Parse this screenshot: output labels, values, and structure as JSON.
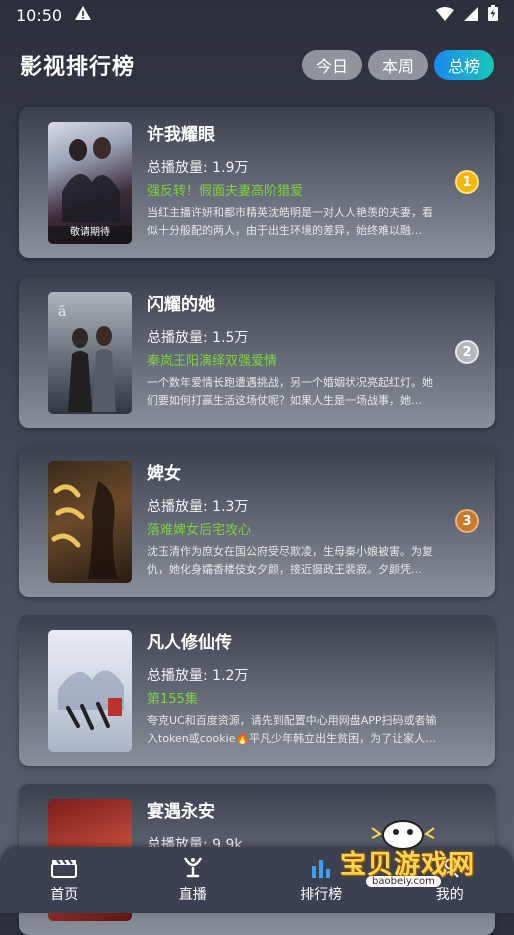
{
  "status_bar": {
    "time": "10:50",
    "icons": [
      "warning-icon",
      "wifi-icon",
      "signal-icon",
      "battery-icon"
    ]
  },
  "header": {
    "title": "影视排行榜",
    "tabs": [
      {
        "label": "今日",
        "active": false
      },
      {
        "label": "本周",
        "active": false
      },
      {
        "label": "总榜",
        "active": true
      }
    ]
  },
  "colors": {
    "active_tab_gradient": [
      "#1d87f0",
      "#17c8b8"
    ],
    "tag_green": "#7fd13f",
    "rank1": "#f2b705",
    "rank2": "#b5b9bf",
    "rank3": "#c77b2e"
  },
  "rankings": [
    {
      "title": "许我耀眼",
      "plays": "总播放量: 1.9万",
      "tagline": "强反转！假面夫妻高阶猎爱",
      "desc": "当红主播许妍和都市精英沈皓明是一对人人艳羡的夫妻，看似十分般配的两人，由于出生环境的差异，始终难以融…",
      "rank": "1",
      "poster_caption": "敬请期待"
    },
    {
      "title": "闪耀的她",
      "plays": "总播放量: 1.5万",
      "tagline": "秦岚王阳演绎双强爱情",
      "desc": "一个数年爱情长跑遭遇挑战，另一个婚姻状况亮起红灯。她们要如何打赢生活这场仗呢？如果人生是一场战事，她…",
      "rank": "2",
      "poster_caption": ""
    },
    {
      "title": "婢女",
      "plays": "总播放量: 1.3万",
      "tagline": "落难婢女后宅攻心",
      "desc": "沈玉清作为庶女在国公府受尽欺凌，生母秦小娘被害。为复仇，她化身孀香楼伎女夕颜，接近摄政王裴寂。夕颜凭…",
      "rank": "3",
      "poster_caption": ""
    },
    {
      "title": "凡人修仙传",
      "plays": "总播放量: 1.2万",
      "tagline": "第155集",
      "desc": "夸克UC和百度资源，请先到配置中心用网盘APP扫码或者输入token或cookie🔥平凡少年韩立出生贫困，为了让家人过上更好…",
      "rank": "",
      "poster_caption": ""
    },
    {
      "title": "宴遇永安",
      "plays": "总播放量: 9.9k",
      "tagline": "",
      "desc": "",
      "rank": "",
      "poster_caption": ""
    }
  ],
  "bottom_nav": [
    {
      "label": "首页",
      "icon": "clapperboard-icon",
      "active": false
    },
    {
      "label": "直播",
      "icon": "satellite-dish-icon",
      "active": false
    },
    {
      "label": "排行榜",
      "icon": "bar-chart-icon",
      "active": true
    },
    {
      "label": "我的",
      "icon": "user-icon",
      "active": false
    }
  ],
  "watermark": {
    "text": "宝贝游戏网",
    "url": "baobeiy.com"
  }
}
